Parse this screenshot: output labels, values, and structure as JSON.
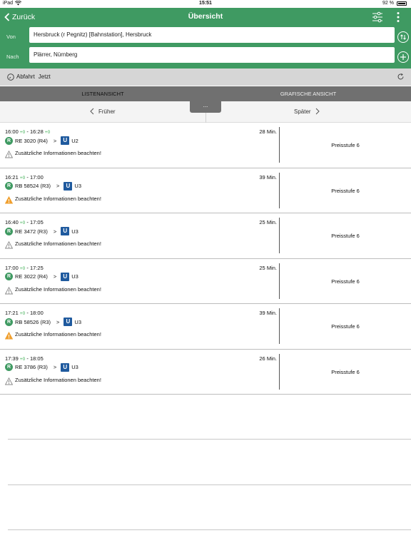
{
  "status_bar": {
    "device": "iPad",
    "time": "15:51",
    "battery": "92 %"
  },
  "nav": {
    "back_label": "Zurück",
    "title": "Übersicht"
  },
  "route": {
    "from_label": "Von",
    "from_value": "Hersbruck (r Pegnitz) [Bahnstation], Hersbruck",
    "to_label": "Nach",
    "to_value": "Plärrer, Nürnberg"
  },
  "departure": {
    "label": "Abfahrt",
    "value": "Jetzt"
  },
  "tabs": [
    {
      "label": "LISTENANSICHT",
      "active": true
    },
    {
      "label": "GRAFISCHE ANSICHT",
      "active": false
    }
  ],
  "pager": {
    "handle": "...",
    "earlier": "Früher",
    "later": "Später"
  },
  "trips": [
    {
      "dep": "16:00",
      "dep_delay": "+0",
      "arr": "16:28",
      "arr_delay": "+0",
      "train": "RE 3020 (R4)",
      "subway": "U2",
      "warning": "Zusätzliche Informationen beachten!",
      "warning_level": "info",
      "duration": "28 Min.",
      "price": "Preisstufe 6"
    },
    {
      "dep": "16:21",
      "dep_delay": "+0",
      "arr": "17:00",
      "arr_delay": "",
      "train": "RB 58524 (R3)",
      "subway": "U3",
      "warning": "Zusätzliche Informationen beachten!",
      "warning_level": "warning",
      "duration": "39 Min.",
      "price": "Preisstufe 6"
    },
    {
      "dep": "16:40",
      "dep_delay": "+0",
      "arr": "17:05",
      "arr_delay": "",
      "train": "RE 3472 (R3)",
      "subway": "U3",
      "warning": "Zusätzliche Informationen beachten!",
      "warning_level": "info",
      "duration": "25 Min.",
      "price": "Preisstufe 6"
    },
    {
      "dep": "17:00",
      "dep_delay": "+0",
      "arr": "17:25",
      "arr_delay": "",
      "train": "RE 3022 (R4)",
      "subway": "U3",
      "warning": "Zusätzliche Informationen beachten!",
      "warning_level": "info",
      "duration": "25 Min.",
      "price": "Preisstufe 6"
    },
    {
      "dep": "17:21",
      "dep_delay": "+0",
      "arr": "18:00",
      "arr_delay": "",
      "train": "RB 58526 (R3)",
      "subway": "U3",
      "warning": "Zusätzliche Informationen beachten!",
      "warning_level": "warning",
      "duration": "39 Min.",
      "price": "Preisstufe 6"
    },
    {
      "dep": "17:39",
      "dep_delay": "+0",
      "arr": "18:05",
      "arr_delay": "",
      "train": "RE 3786 (R3)",
      "subway": "U3",
      "warning": "Zusätzliche Informationen beachten!",
      "warning_level": "info",
      "duration": "26 Min.",
      "price": "Preisstufe 6"
    }
  ],
  "badges": {
    "rail": "R",
    "subway": "U"
  },
  "colors": {
    "header": "#3f9a62",
    "delay": "#3cae52",
    "subway_badge": "#1f5a9e",
    "warning": "#f0a030",
    "info": "#888888"
  },
  "icons": {
    "back": "chevron-left-icon",
    "filter": "sliders-icon",
    "more": "vertical-ellipsis-icon",
    "swap": "swap-icon",
    "add": "plus-icon",
    "clock": "clock-icon",
    "refresh": "refresh-icon",
    "warning": "warning-triangle-icon"
  }
}
